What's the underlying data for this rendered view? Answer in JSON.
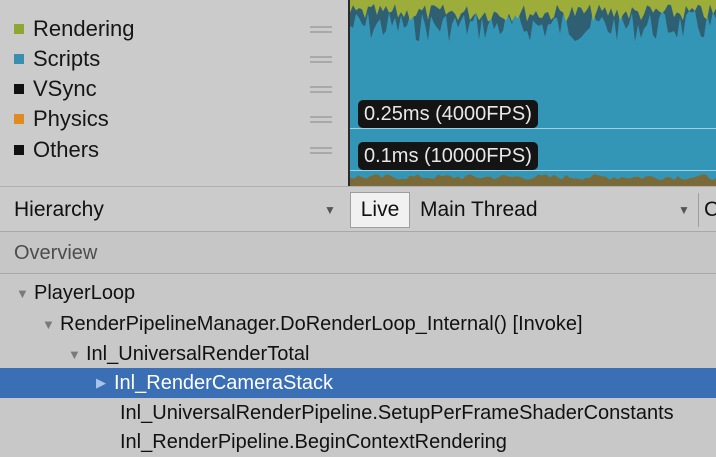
{
  "legend": {
    "items": [
      {
        "label": "Rendering",
        "color": "#8ea632"
      },
      {
        "label": "Scripts",
        "color": "#3a8fb0"
      },
      {
        "label": "VSync",
        "color": "#111111"
      },
      {
        "label": "Physics",
        "color": "#e08a20"
      },
      {
        "label": "Others",
        "color": "#111111"
      }
    ]
  },
  "chart": {
    "markers": [
      {
        "label": "0.25ms (4000FPS)"
      },
      {
        "label": "0.1ms (10000FPS)"
      }
    ]
  },
  "toolbar": {
    "hierarchy_label": "Hierarchy",
    "live_label": "Live",
    "thread_label": "Main Thread",
    "cut_label": "C"
  },
  "overview": {
    "label": "Overview"
  },
  "tree": {
    "rows": [
      {
        "label": "PlayerLoop",
        "arrow": "▼",
        "selected": false
      },
      {
        "label": "RenderPipelineManager.DoRenderLoop_Internal() [Invoke]",
        "arrow": "▼",
        "selected": false
      },
      {
        "label": "Inl_UniversalRenderTotal",
        "arrow": "▼",
        "selected": false
      },
      {
        "label": "Inl_RenderCameraStack",
        "arrow": "▶",
        "selected": true
      },
      {
        "label": "Inl_UniversalRenderPipeline.SetupPerFrameShaderConstants",
        "arrow": "",
        "selected": false
      },
      {
        "label": "Inl_RenderPipeline.BeginContextRendering",
        "arrow": "",
        "selected": false
      }
    ]
  }
}
